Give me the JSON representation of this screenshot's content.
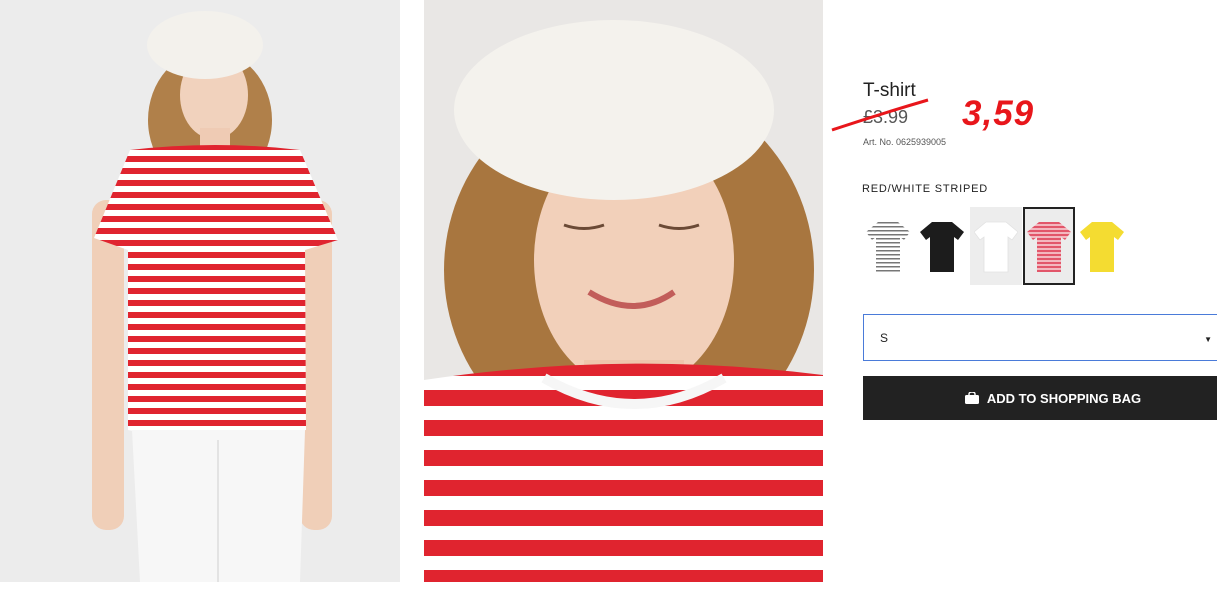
{
  "product": {
    "title": "T-shirt",
    "old_price": "£3.99",
    "new_price": "3,59",
    "article_number": "Art. No. 0625939005",
    "color_name": "RED/WHITE STRIPED"
  },
  "swatches": [
    {
      "name": "grey-striped",
      "icon": "tshirt-icon",
      "color": "#d9d9d9"
    },
    {
      "name": "black",
      "icon": "tshirt-icon",
      "color": "#1c1c1c"
    },
    {
      "name": "white",
      "icon": "tshirt-icon",
      "color": "#ffffff"
    },
    {
      "name": "red-white-striped",
      "icon": "tshirt-icon",
      "color": "#e26a78",
      "selected": true
    },
    {
      "name": "yellow",
      "icon": "tshirt-icon",
      "color": "#f4dc31"
    }
  ],
  "size_select": {
    "value": "S"
  },
  "add_button": {
    "label": "ADD TO SHOPPING BAG",
    "icon": "shopping-bag-icon"
  },
  "colors": {
    "accent_red": "#e8161b",
    "button_bg": "#222222",
    "select_border": "#4a7bd9"
  }
}
